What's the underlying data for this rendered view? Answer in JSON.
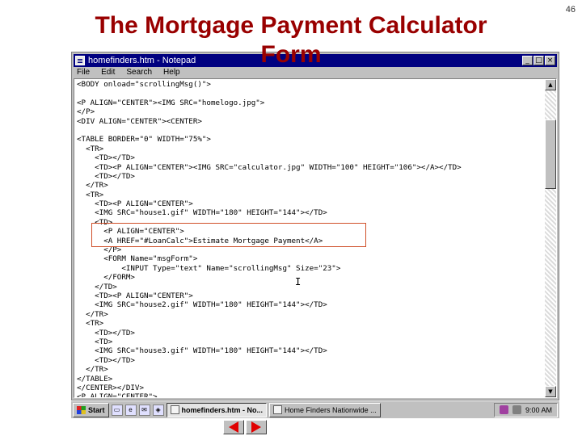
{
  "slide": {
    "title_line1": "The Mortgage Payment Calculator",
    "title_line2": "Form",
    "page_number": "46"
  },
  "window": {
    "title": "homefinders.htm - Notepad",
    "buttons": [
      "_",
      "□",
      "×"
    ]
  },
  "menu": [
    "File",
    "Edit",
    "Search",
    "Help"
  ],
  "code_lines": [
    "<BODY onload=\"scrollingMsg()\">",
    "",
    "<P ALIGN=\"CENTER\"><IMG SRC=\"homelogo.jpg\">",
    "</P>",
    "<DIV ALIGN=\"CENTER\"><CENTER>",
    "",
    "<TABLE BORDER=\"0\" WIDTH=\"75%\">",
    "  <TR>",
    "    <TD></TD>",
    "    <TD><P ALIGN=\"CENTER\"><IMG SRC=\"calculator.jpg\" WIDTH=\"100\" HEIGHT=\"106\"></A></TD>",
    "    <TD></TD>",
    "  </TR>",
    "  <TR>",
    "    <TD><P ALIGN=\"CENTER\">",
    "    <IMG SRC=\"house1.gif\" WIDTH=\"180\" HEIGHT=\"144\"></TD>",
    "    <TD>",
    "      <P ALIGN=\"CENTER\">",
    "      <A HREF=\"#LoanCalc\">Estimate Mortgage Payment</A>",
    "      </P>",
    "      <FORM Name=\"msgForm\">",
    "          <INPUT Type=\"text\" Name=\"scrollingMsg\" Size=\"23\">",
    "      </FORM>",
    "    </TD>",
    "    <TD><P ALIGN=\"CENTER\">",
    "    <IMG SRC=\"house2.gif\" WIDTH=\"180\" HEIGHT=\"144\"></TD>",
    "  </TR>",
    "  <TR>",
    "    <TD></TD>",
    "    <TD>",
    "    <IMG SRC=\"house3.gif\" WIDTH=\"180\" HEIGHT=\"144\"></TD>",
    "    <TD></TD>",
    "  </TR>",
    "</TABLE>",
    "</CENTER></DIV>",
    "<P ALIGN=\"CENTER\">"
  ],
  "taskbar": {
    "start": "Start",
    "task1": "homefinders.htm - No...",
    "task2": "Home Finders Nationwide ...",
    "clock": "9:00 AM"
  },
  "colors": {
    "title": "#990000",
    "window_titlebar": "#000080",
    "highlight": "#d0502a",
    "nav_arrow": "#e00000"
  }
}
